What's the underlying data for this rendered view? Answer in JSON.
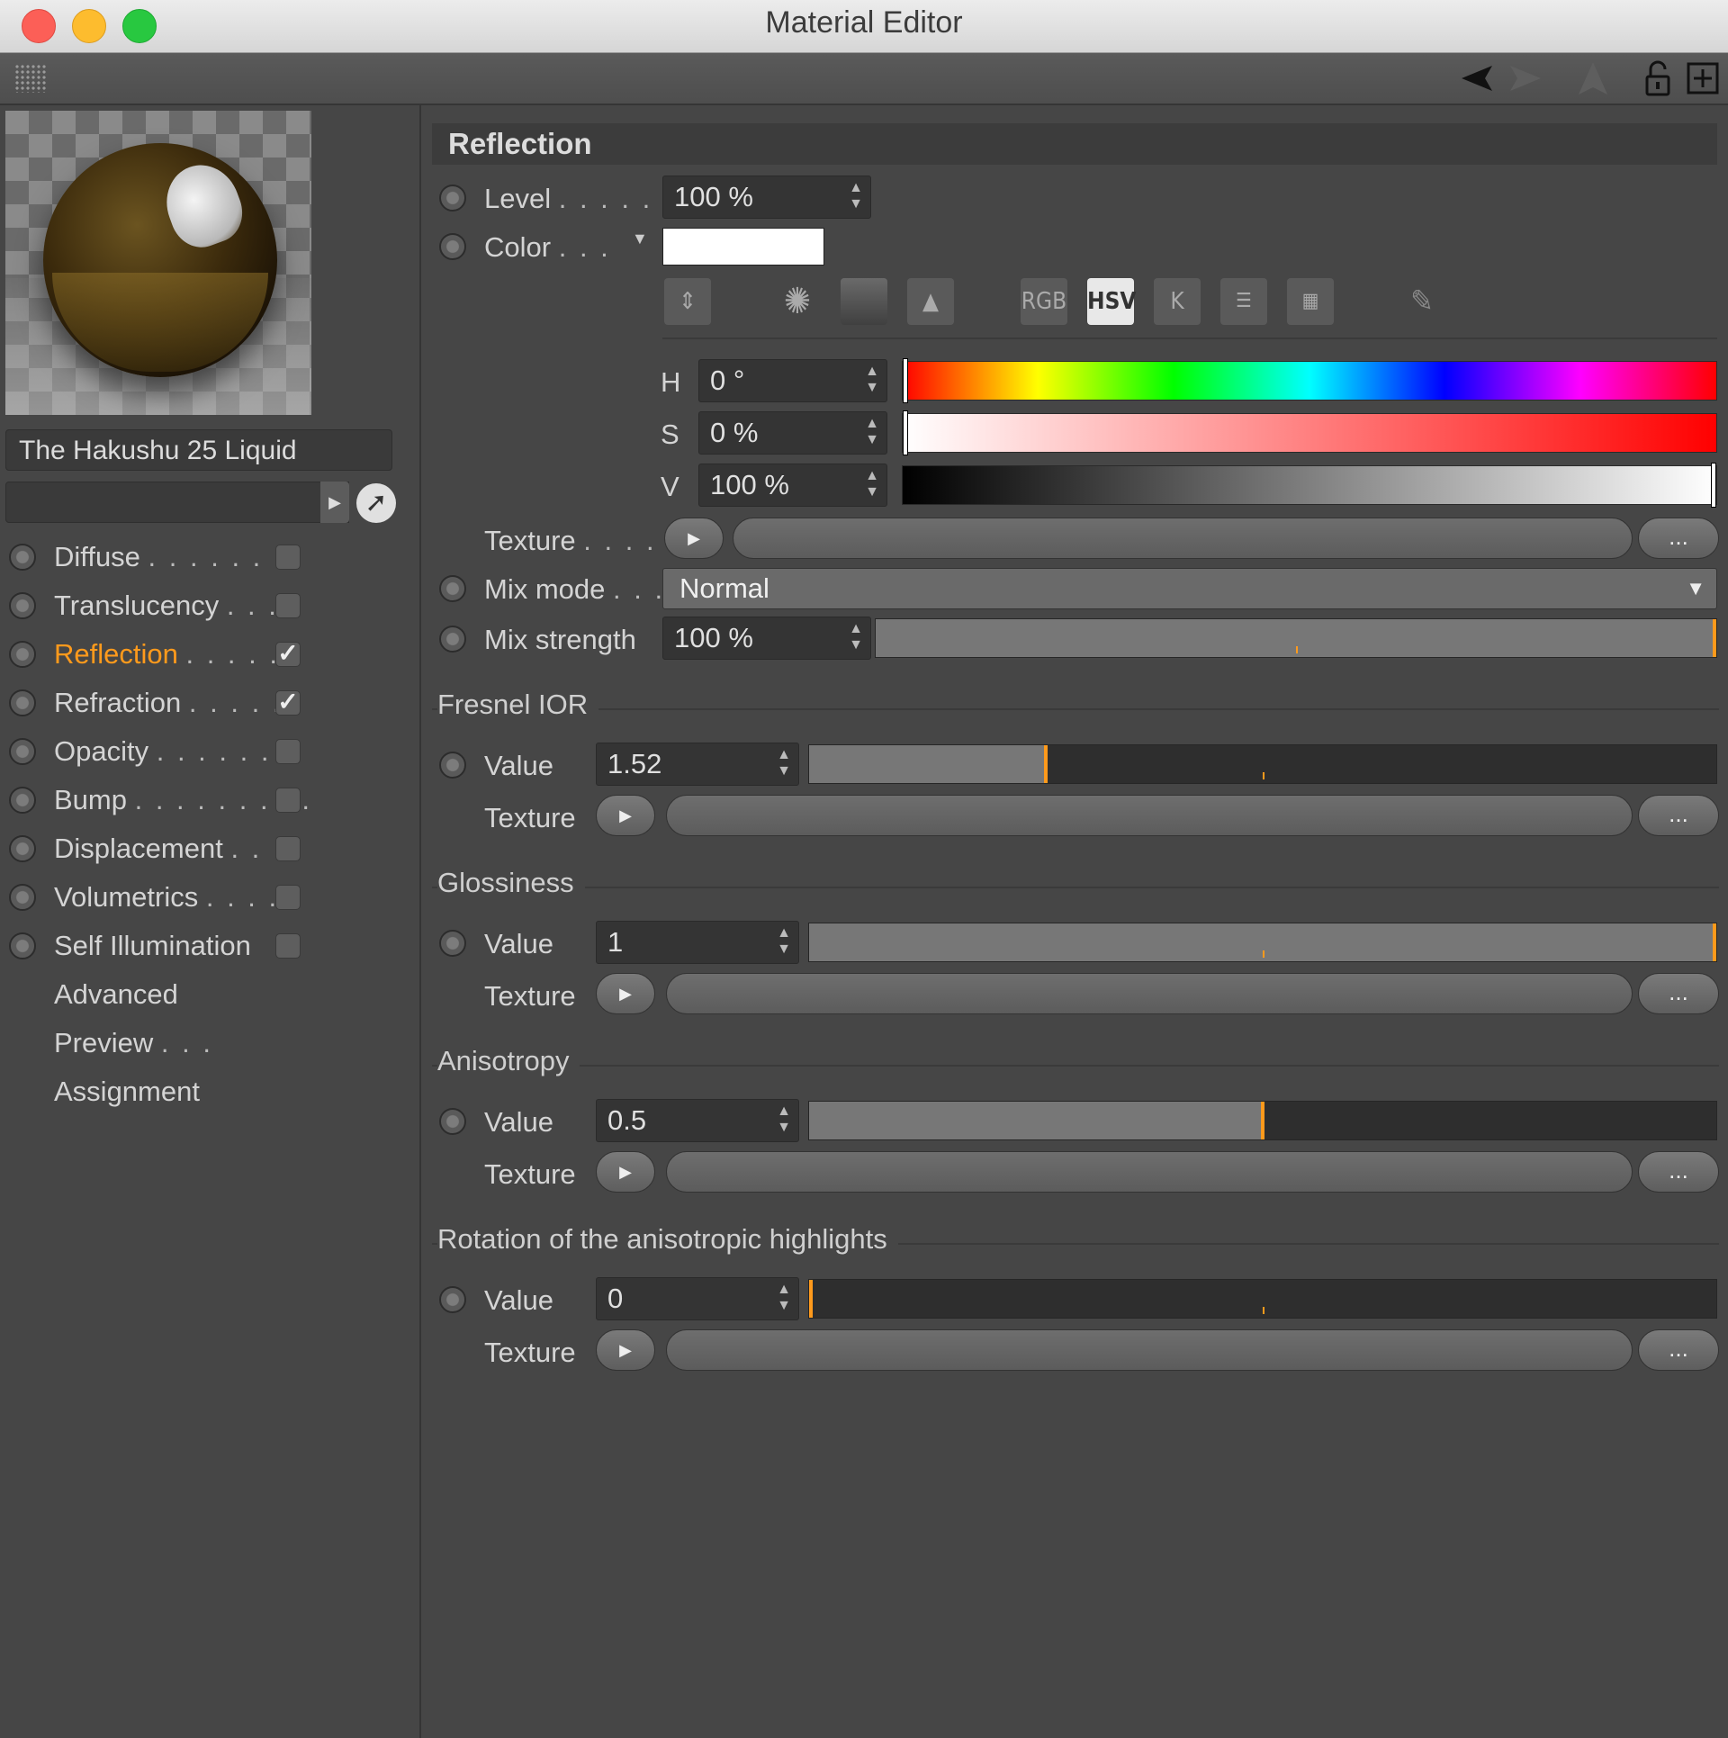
{
  "window": {
    "title": "Material Editor"
  },
  "material": {
    "name": "The Hakushu 25 Liquid"
  },
  "channels": [
    {
      "label": "Diffuse",
      "dots": ". . . . . . . .",
      "checked": false,
      "active": false
    },
    {
      "label": "Translucency",
      "dots": ". . .",
      "checked": false,
      "active": false
    },
    {
      "label": "Reflection",
      "dots": ". . . . .",
      "checked": true,
      "active": true
    },
    {
      "label": "Refraction",
      "dots": ". . . . .",
      "checked": true,
      "active": false
    },
    {
      "label": "Opacity",
      "dots": ". . . . . . .",
      "checked": false,
      "active": false
    },
    {
      "label": "Bump",
      "dots": ". . . . . . . . .",
      "checked": false,
      "active": false
    },
    {
      "label": "Displacement",
      "dots": ". .",
      "checked": false,
      "active": false
    },
    {
      "label": "Volumetrics",
      "dots": ". . . .",
      "checked": false,
      "active": false
    },
    {
      "label": "Self Illumination",
      "dots": "",
      "checked": false,
      "active": false
    }
  ],
  "extra_sections": [
    {
      "label": "Advanced"
    },
    {
      "label": "Preview",
      "dots": ". . ."
    },
    {
      "label": "Assignment"
    }
  ],
  "reflection": {
    "title": "Reflection",
    "level": {
      "label": "Level",
      "dots": ". . . . . .",
      "value": "100 %"
    },
    "color": {
      "label": "Color",
      "dots": ". . .",
      "swatch": "#ffffff"
    },
    "color_modes": [
      "RGB",
      "HSV",
      "K"
    ],
    "active_mode": "HSV",
    "hsv": {
      "h": {
        "label": "H",
        "value": "0 °",
        "fraction": 0.0
      },
      "s": {
        "label": "S",
        "value": "0 %",
        "fraction": 0.0
      },
      "v": {
        "label": "V",
        "value": "100 %",
        "fraction": 1.0
      }
    },
    "texture": {
      "label": "Texture",
      "dots": ". . . . .",
      "more": "..."
    },
    "mix_mode": {
      "label": "Mix mode",
      "dots": ". . .",
      "value": "Normal"
    },
    "mix_strength": {
      "label": "Mix strength",
      "value": "100 %",
      "fraction": 1.0
    }
  },
  "groups": [
    {
      "title": "Fresnel IOR",
      "value_label": "Value",
      "value": "1.52",
      "fraction": 0.26,
      "texture_label": "Texture",
      "more": "..."
    },
    {
      "title": "Glossiness",
      "value_label": "Value",
      "value": "1",
      "fraction": 1.0,
      "texture_label": "Texture",
      "more": "..."
    },
    {
      "title": "Anisotropy",
      "value_label": "Value",
      "value": "0.5",
      "fraction": 0.5,
      "texture_label": "Texture",
      "more": "..."
    },
    {
      "title": "Rotation of the anisotropic highlights",
      "value_label": "Value",
      "value": "0",
      "fraction": 0.0,
      "texture_label": "Texture",
      "more": "..."
    }
  ],
  "colors": {
    "accent": "#ff9a1c",
    "background": "#464646",
    "active_channel": "#ff9a1c"
  }
}
